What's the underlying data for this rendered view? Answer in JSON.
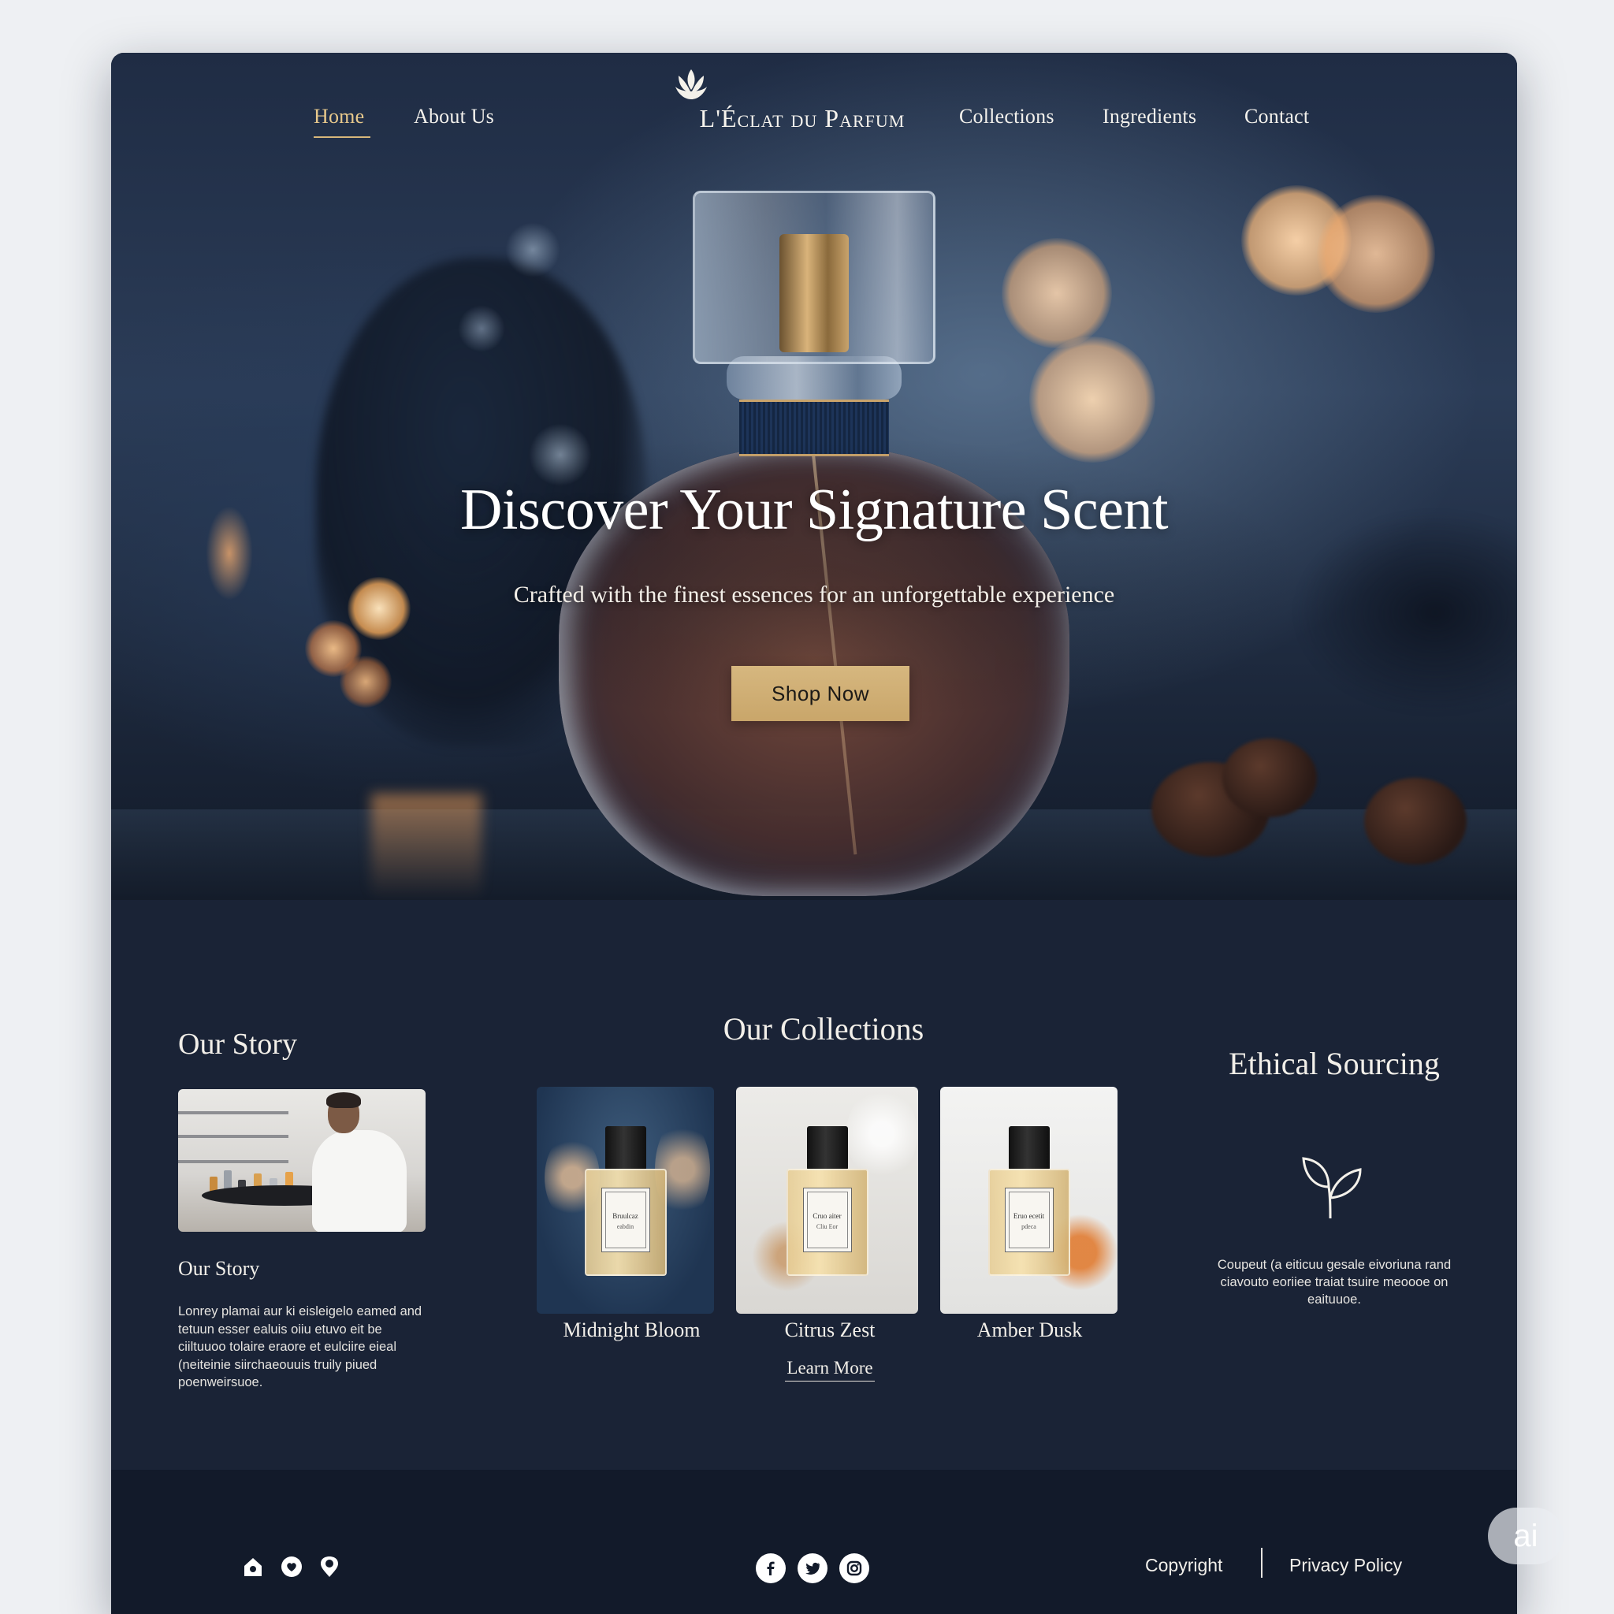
{
  "brand": {
    "name": "L'Éclat du Parfum"
  },
  "nav": {
    "home": "Home",
    "about": "About Us",
    "collections": "Collections",
    "ingredients": "Ingredients",
    "contact": "Contact",
    "active": "Home"
  },
  "hero": {
    "title": "Discover Your Signature Scent",
    "subtitle": "Crafted with the finest essences for an unforgettable experience",
    "cta": "Shop Now"
  },
  "story": {
    "heading": "Our Story",
    "caption": "Our Story",
    "text": "Lonrey plamai aur ki eisleigelo eamed and tetuun esser ealuis oiiu etuvo eit be ciiltuuoo tolaire eraore et eulciire eieal (neiteinie siirchaeouuis truily piued poenweirsuoe."
  },
  "collections": {
    "heading": "Our Collections",
    "items": [
      {
        "name": "Midnight Bloom",
        "label_line1": "Bruulcaz",
        "label_line2": "eabdin"
      },
      {
        "name": "Citrus Zest",
        "label_line1": "Cruo aiter",
        "label_line2": "Cliu Eor"
      },
      {
        "name": "Amber Dusk",
        "label_line1": "Eruo ecetit",
        "label_line2": "pdeca"
      }
    ],
    "learn_more": "Learn More"
  },
  "ethical": {
    "heading": "Ethical Sourcing",
    "text": "Coupeut (a eiticuu gesale eivoriuna rand ciavouto eoriiee traiat tsuire meoooe on eaituuoe."
  },
  "footer": {
    "icons": [
      "home-icon",
      "heart-icon",
      "map-pin-icon"
    ],
    "social": [
      "facebook-icon",
      "twitter-icon",
      "instagram-icon"
    ],
    "copyright": "Copyright",
    "privacy": "Privacy Policy"
  },
  "badge": {
    "text": "ai"
  },
  "colors": {
    "accent_gold": "#d6b77f",
    "navy": "#1a2336",
    "footer_navy": "#121a2a"
  }
}
